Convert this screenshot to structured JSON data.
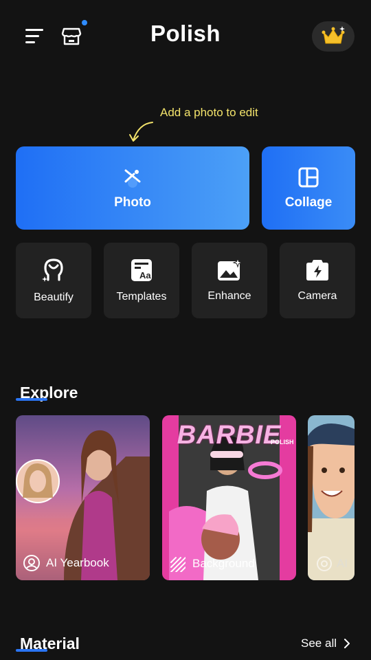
{
  "header": {
    "app_title": "Polish",
    "icons": {
      "menu": "menu-icon",
      "store": "store-icon",
      "premium": "crown-icon"
    },
    "store_badge_color": "#2f8cff"
  },
  "hint": {
    "text": "Add a photo to edit"
  },
  "primary_actions": [
    {
      "label": "Photo",
      "icon": "magic-wand-icon"
    },
    {
      "label": "Collage",
      "icon": "grid-icon"
    }
  ],
  "tools": [
    {
      "label": "Beautify",
      "icon": "face-sparkle-icon"
    },
    {
      "label": "Templates",
      "icon": "template-icon"
    },
    {
      "label": "Enhance",
      "icon": "image-sparkle-icon"
    },
    {
      "label": "Camera",
      "icon": "camera-flash-icon"
    }
  ],
  "explore": {
    "title": "Explore",
    "cards": [
      {
        "label": "AI Yearbook",
        "icon": "face-scan-icon"
      },
      {
        "label": "Background",
        "icon": "stripes-icon"
      },
      {
        "label": "AI",
        "icon": "camera-icon"
      }
    ],
    "poster_text": "BARBIE",
    "poster_tag": "POLISH"
  },
  "material": {
    "title": "Material",
    "see_all": "See all"
  },
  "colors": {
    "accent": "#2a74f2",
    "background": "#131313",
    "hint": "#f3e36b"
  }
}
